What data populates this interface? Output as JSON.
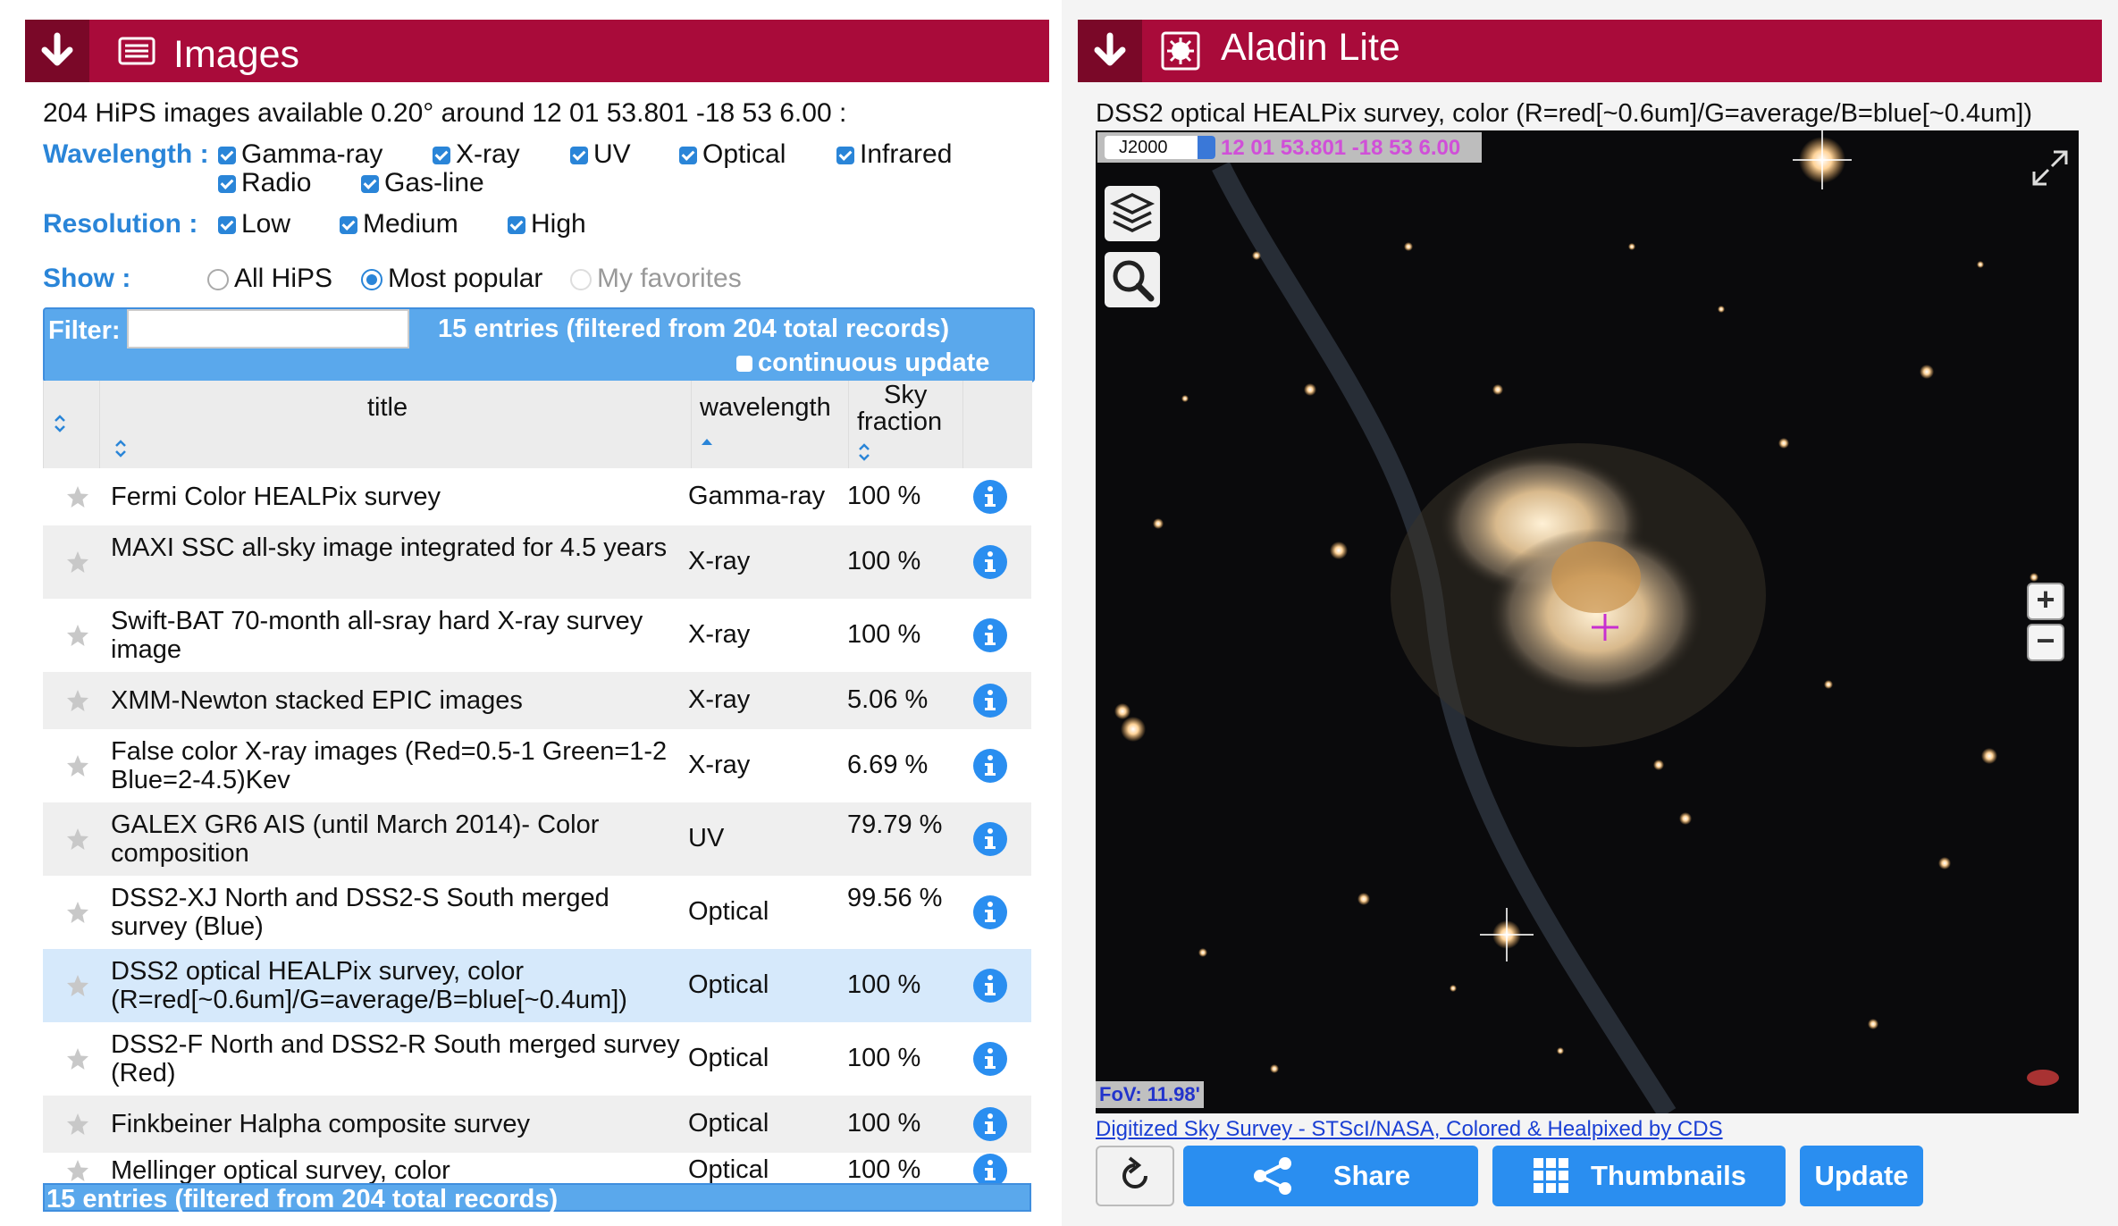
{
  "images_panel": {
    "title": "Images",
    "summary": "204 HiPS images available 0.20° around 12 01 53.801 -18 53 6.00 :",
    "wavelength_label": "Wavelength :",
    "wavelengths": [
      "Gamma-ray",
      "X-ray",
      "UV",
      "Optical",
      "Infrared",
      "Radio",
      "Gas-line"
    ],
    "resolution_label": "Resolution :",
    "resolutions": [
      "Low",
      "Medium",
      "High"
    ],
    "show_label": "Show :",
    "show_options": [
      "All HiPS",
      "Most popular",
      "My favorites"
    ],
    "show_selected": "Most popular",
    "filter_label": "Filter:",
    "filter_value": "",
    "entries_text": "15 entries (filtered from 204 total records)",
    "continuous_update": "continuous update",
    "columns": [
      "title",
      "wavelength",
      "Sky",
      "fraction"
    ],
    "rows": [
      {
        "title": "Fermi Color HEALPix survey",
        "wavelength": "Gamma-ray",
        "sky_fraction": "100 %"
      },
      {
        "title": "MAXI SSC all-sky image integrated for 4.5 years",
        "wavelength": "X-ray",
        "sky_fraction": "100 %"
      },
      {
        "title": "Swift-BAT 70-month all-sray hard X-ray survey image",
        "wavelength": "X-ray",
        "sky_fraction": "100 %"
      },
      {
        "title": "XMM-Newton stacked EPIC images",
        "wavelength": "X-ray",
        "sky_fraction": "5.06 %"
      },
      {
        "title": "False color X-ray images (Red=0.5-1 Green=1-2 Blue=2-4.5)Kev",
        "wavelength": "X-ray",
        "sky_fraction": "6.69 %"
      },
      {
        "title": "GALEX GR6 AIS (until March 2014)- Color composition",
        "wavelength": "UV",
        "sky_fraction": "79.79 %"
      },
      {
        "title": "DSS2-XJ North and DSS2-S South merged survey (Blue)",
        "wavelength": "Optical",
        "sky_fraction": "99.56 %"
      },
      {
        "title": "DSS2 optical HEALPix survey, color (R=red[~0.6um]/G=average/B=blue[~0.4um])",
        "wavelength": "Optical",
        "sky_fraction": "100 %"
      },
      {
        "title": "DSS2-F North and DSS2-R South merged survey (Red)",
        "wavelength": "Optical",
        "sky_fraction": "100 %"
      },
      {
        "title": "Finkbeiner Halpha composite survey",
        "wavelength": "Optical",
        "sky_fraction": "100 %"
      },
      {
        "title": "Mellinger optical survey, color",
        "wavelength": "Optical",
        "sky_fraction": "100 %"
      }
    ],
    "selected_row": 7
  },
  "aladin_panel": {
    "title": "Aladin Lite",
    "survey_name": "DSS2 optical HEALPix survey, color (R=red[~0.6um]/G=average/B=blue[~0.4um])",
    "frame": "J2000",
    "coords": "12 01 53.801 -18 53 6.00",
    "fov": "FoV: 11.98'",
    "credit": "Digitized Sky Survey - STScI/NASA, Colored & Healpixed by CDS",
    "buttons": {
      "share": "Share",
      "thumbnails": "Thumbnails",
      "update": "Update"
    }
  },
  "colors": {
    "header": "#a90b3a",
    "header_dark": "#7a0828",
    "accent": "#2a85d8",
    "button": "#2a8ef0",
    "selected_row": "#d6e9fb"
  }
}
